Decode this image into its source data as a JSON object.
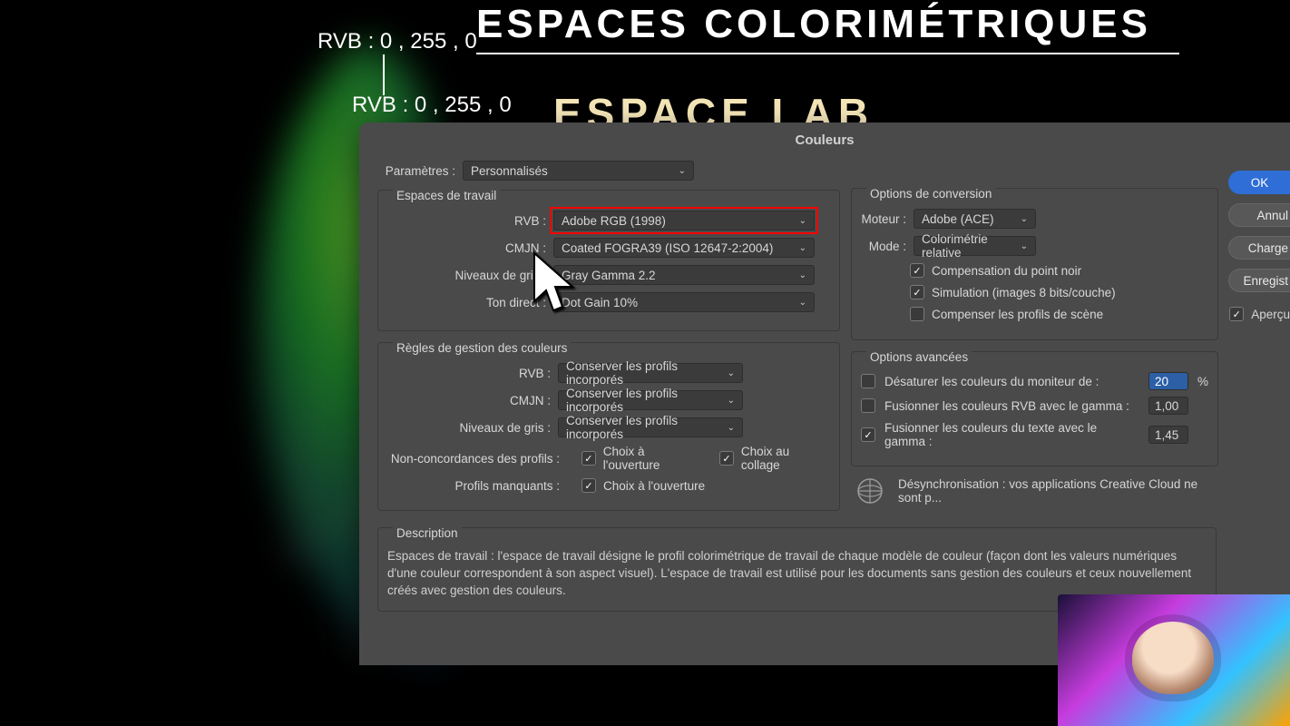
{
  "bg": {
    "rgb_label_1": "RVB : 0 , 255 , 0",
    "rgb_label_2": "RVB : 0 , 255 , 0",
    "title_main": "ESPACES COLORIMÉTRIQUES",
    "title_sub": "ESPACE LAB"
  },
  "dialog": {
    "title": "Couleurs",
    "params_label": "Paramètres :",
    "params_value": "Personnalisés",
    "workspaces": {
      "legend": "Espaces de travail",
      "rvb_label": "RVB :",
      "rvb_value": "Adobe RGB (1998)",
      "cmjn_label": "CMJN :",
      "cmjn_value": "Coated FOGRA39 (ISO 12647-2:2004)",
      "gray_label": "Niveaux de gris :",
      "gray_value": "Gray Gamma 2.2",
      "spot_label": "Ton direct :",
      "spot_value": "Dot Gain 10%"
    },
    "rules": {
      "legend": "Règles de gestion des couleurs",
      "rvb_label": "RVB :",
      "rvb_value": "Conserver les profils incorporés",
      "cmjn_label": "CMJN :",
      "cmjn_value": "Conserver les profils incorporés",
      "gray_label": "Niveaux de gris :",
      "gray_value": "Conserver les profils incorporés",
      "mismatch_label": "Non-concordances des profils :",
      "mismatch_open": "Choix à l'ouverture",
      "mismatch_paste": "Choix au collage",
      "missing_label": "Profils manquants :",
      "missing_open": "Choix à l'ouverture"
    },
    "conv": {
      "legend": "Options de conversion",
      "engine_label": "Moteur :",
      "engine_value": "Adobe (ACE)",
      "mode_label": "Mode :",
      "mode_value": "Colorimétrie relative",
      "bpc": "Compensation du point noir",
      "sim": "Simulation (images 8 bits/couche)",
      "scene": "Compenser les profils de scène"
    },
    "adv": {
      "legend": "Options avancées",
      "desat": "Désaturer les couleurs du moniteur de :",
      "desat_val": "20",
      "desat_unit": "%",
      "merge_rvb": "Fusionner les couleurs RVB avec le gamma :",
      "merge_rvb_val": "1,00",
      "merge_txt": "Fusionner les couleurs du texte avec le gamma :",
      "merge_txt_val": "1,45"
    },
    "desync": "Désynchronisation : vos applications Creative Cloud ne sont p...",
    "desc": {
      "legend": "Description",
      "body": "Espaces de travail : l'espace de travail désigne le profil colorimétrique de travail de chaque modèle de couleur (façon dont les valeurs numériques d'une couleur correspondent à son aspect visuel). L'espace de travail est utilisé pour les documents sans gestion des couleurs et ceux nouvellement créés avec gestion des couleurs."
    },
    "buttons": {
      "ok": "OK",
      "cancel": "Annul",
      "load": "Charge",
      "save": "Enregist",
      "preview": "Aperçu"
    }
  }
}
